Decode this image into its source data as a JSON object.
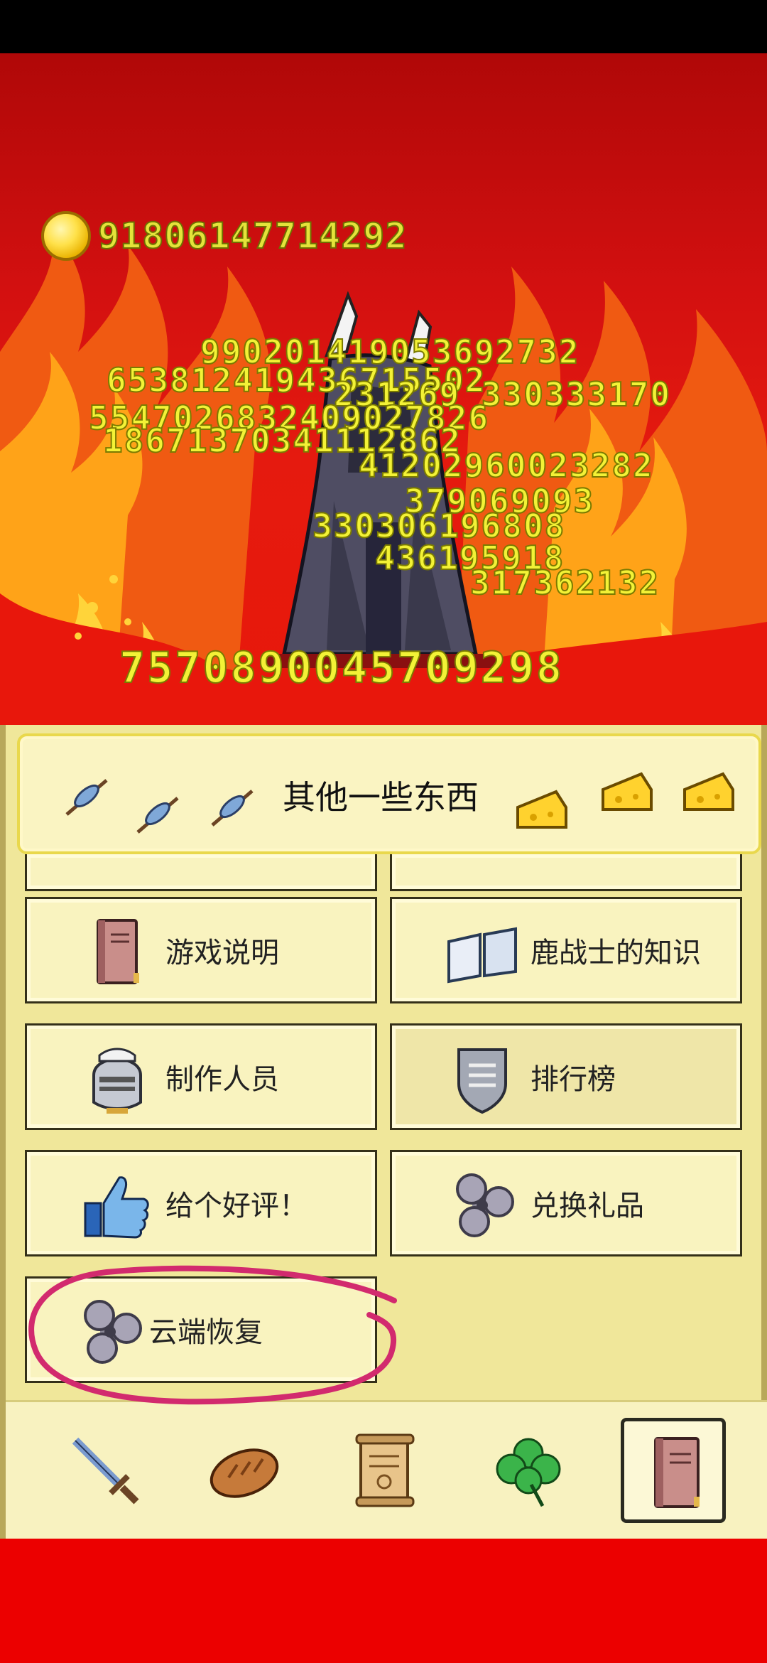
{
  "gold": {
    "value": "91806147714292",
    "icon": "gold-coin-icon"
  },
  "damage_numbers": [
    "990201419053692732",
    "653812419436715502",
    "231269 330333170",
    "5547026832409027826",
    "18671370341112862",
    "41202960023282",
    "379069093",
    "330306196808",
    "436195918",
    "317362132"
  ],
  "total_damage": "7570890045709298",
  "panel": {
    "title": "其他一些东西",
    "header_icons": [
      "fish-skewer-icon",
      "fish-skewer-icon",
      "fish-skewer-icon",
      "cheese-icon",
      "cheese-icon",
      "cheese-icon"
    ]
  },
  "menu": [
    {
      "label": "游戏说明",
      "icon": "book-icon"
    },
    {
      "label": "鹿战士的知识",
      "icon": "open-book-icon"
    },
    {
      "label": "制作人员",
      "icon": "helmet-icon"
    },
    {
      "label": "排行榜",
      "icon": "shield-icon"
    },
    {
      "label": "给个好评！",
      "icon": "thumbs-up-icon"
    },
    {
      "label": "兑换礼品",
      "icon": "triskelion-icon"
    },
    {
      "label": "云端恢复",
      "icon": "triskelion-icon"
    }
  ],
  "tabs": [
    "sword-icon",
    "bread-icon",
    "scroll-icon",
    "clover-icon",
    "book-icon"
  ],
  "colors": {
    "scene_red": "#d31010",
    "damage_yellow": "#f3f236",
    "panel_cream": "#f0e79a",
    "annotation_pink": "#d22a6e"
  }
}
